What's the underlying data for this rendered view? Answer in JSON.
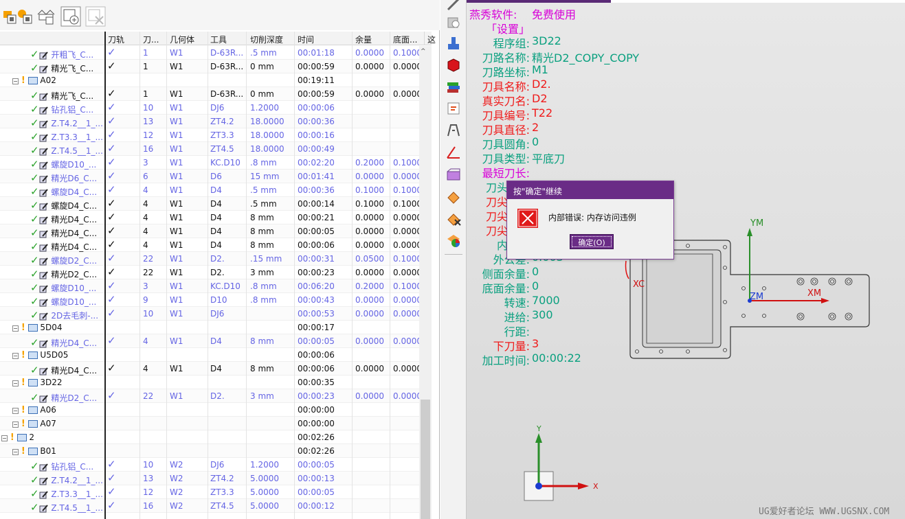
{
  "columns": [
    "刀轨",
    "刀...",
    "几何体",
    "工具",
    "切削深度",
    "时间",
    "余量",
    "底面...",
    "这"
  ],
  "rows": [
    {
      "depth": 3,
      "kind": "op",
      "style": "blue",
      "name": "开粗飞_C...",
      "cells": [
        "1",
        "W1",
        "D-63R...",
        ".5 mm",
        "00:01:18",
        "0.0000",
        "0.1000"
      ]
    },
    {
      "depth": 3,
      "kind": "op",
      "style": "black",
      "name": "精光飞_C...",
      "cells": [
        "1",
        "W1",
        "D-63R...",
        "0 mm",
        "00:00:59",
        "0.0000",
        "0.0000"
      ]
    },
    {
      "depth": 2,
      "kind": "group",
      "style": "group",
      "name": "A02",
      "cells": [
        "",
        "",
        "",
        "",
        "00:19:11",
        "",
        ""
      ]
    },
    {
      "depth": 3,
      "kind": "op",
      "style": "black",
      "name": "精光飞_C...",
      "cells": [
        "1",
        "W1",
        "D-63R...",
        "0 mm",
        "00:00:59",
        "0.0000",
        "0.0000"
      ]
    },
    {
      "depth": 3,
      "kind": "op",
      "style": "blue",
      "name": "钻孔铝_C...",
      "cells": [
        "10",
        "W1",
        "DJ6",
        "1.2000",
        "00:00:06",
        "",
        ""
      ]
    },
    {
      "depth": 3,
      "kind": "op",
      "style": "blue",
      "name": "Z.T4.2__1_...",
      "cells": [
        "13",
        "W1",
        "ZT4.2",
        "18.0000",
        "00:00:36",
        "",
        ""
      ]
    },
    {
      "depth": 3,
      "kind": "op",
      "style": "blue",
      "name": "Z.T3.3__1_...",
      "cells": [
        "12",
        "W1",
        "ZT3.3",
        "18.0000",
        "00:00:16",
        "",
        ""
      ]
    },
    {
      "depth": 3,
      "kind": "op",
      "style": "blue",
      "name": "Z.T4.5__1_...",
      "cells": [
        "16",
        "W1",
        "ZT4.5",
        "18.0000",
        "00:00:49",
        "",
        ""
      ]
    },
    {
      "depth": 3,
      "kind": "op",
      "style": "blue",
      "name": "螺旋D10_...",
      "cells": [
        "3",
        "W1",
        "KC.D10",
        ".8 mm",
        "00:02:20",
        "0.2000",
        "0.1000"
      ]
    },
    {
      "depth": 3,
      "kind": "op",
      "style": "blue",
      "name": "精光D6_C...",
      "cells": [
        "6",
        "W1",
        "D6",
        "15 mm",
        "00:01:41",
        "0.0000",
        "0.0000"
      ]
    },
    {
      "depth": 3,
      "kind": "op",
      "style": "blue",
      "name": "螺旋D4_C...",
      "cells": [
        "4",
        "W1",
        "D4",
        ".5 mm",
        "00:00:36",
        "0.1000",
        "0.1000"
      ]
    },
    {
      "depth": 3,
      "kind": "op",
      "style": "black",
      "name": "螺旋D4_C...",
      "cells": [
        "4",
        "W1",
        "D4",
        ".5 mm",
        "00:00:14",
        "0.1000",
        "0.1000"
      ]
    },
    {
      "depth": 3,
      "kind": "op",
      "style": "black",
      "name": "精光D4_C...",
      "cells": [
        "4",
        "W1",
        "D4",
        "8 mm",
        "00:00:21",
        "0.0000",
        "0.0000"
      ]
    },
    {
      "depth": 3,
      "kind": "op",
      "style": "black",
      "name": "精光D4_C...",
      "cells": [
        "4",
        "W1",
        "D4",
        "8 mm",
        "00:00:05",
        "0.0000",
        "0.0000"
      ]
    },
    {
      "depth": 3,
      "kind": "op",
      "style": "black",
      "name": "精光D4_C...",
      "cells": [
        "4",
        "W1",
        "D4",
        "8 mm",
        "00:00:06",
        "0.0000",
        "0.0000"
      ]
    },
    {
      "depth": 3,
      "kind": "op",
      "style": "blue",
      "name": "螺旋D2_C...",
      "cells": [
        "22",
        "W1",
        "D2.",
        ".15 mm",
        "00:00:31",
        "0.0500",
        "0.1000"
      ]
    },
    {
      "depth": 3,
      "kind": "op",
      "style": "black",
      "name": "精光D2_C...",
      "cells": [
        "22",
        "W1",
        "D2.",
        "3 mm",
        "00:00:23",
        "0.0000",
        "0.0000"
      ]
    },
    {
      "depth": 3,
      "kind": "op",
      "style": "blue",
      "name": "螺旋D10_...",
      "cells": [
        "3",
        "W1",
        "KC.D10",
        ".8 mm",
        "00:06:20",
        "0.2000",
        "0.1000"
      ]
    },
    {
      "depth": 3,
      "kind": "op",
      "style": "blue",
      "name": "螺旋D10_...",
      "cells": [
        "9",
        "W1",
        "D10",
        ".8 mm",
        "00:00:43",
        "0.0000",
        "0.0000"
      ]
    },
    {
      "depth": 3,
      "kind": "op",
      "style": "blue",
      "name": "2D去毛刺-...",
      "cells": [
        "10",
        "W1",
        "DJ6",
        "",
        "00:00:53",
        "0.0000",
        "0.0000"
      ]
    },
    {
      "depth": 2,
      "kind": "group",
      "style": "group",
      "name": "5D04",
      "cells": [
        "",
        "",
        "",
        "",
        "00:00:17",
        "",
        ""
      ]
    },
    {
      "depth": 3,
      "kind": "op",
      "style": "blue",
      "name": "精光D4_C...",
      "cells": [
        "4",
        "W1",
        "D4",
        "8 mm",
        "00:00:05",
        "0.0000",
        "0.0000"
      ]
    },
    {
      "depth": 2,
      "kind": "group",
      "style": "group",
      "name": "U5D05",
      "cells": [
        "",
        "",
        "",
        "",
        "00:00:06",
        "",
        ""
      ]
    },
    {
      "depth": 3,
      "kind": "op",
      "style": "black",
      "name": "精光D4_C...",
      "cells": [
        "4",
        "W1",
        "D4",
        "8 mm",
        "00:00:06",
        "0.0000",
        "0.0000"
      ]
    },
    {
      "depth": 2,
      "kind": "group",
      "style": "group",
      "name": "3D22",
      "cells": [
        "",
        "",
        "",
        "",
        "00:00:35",
        "",
        ""
      ]
    },
    {
      "depth": 3,
      "kind": "op",
      "style": "blue",
      "name": "精光D2_C...",
      "cells": [
        "22",
        "W1",
        "D2.",
        "3 mm",
        "00:00:23",
        "0.0000",
        "0.0000"
      ]
    },
    {
      "depth": 2,
      "kind": "group",
      "style": "group",
      "name": "A06",
      "cells": [
        "",
        "",
        "",
        "",
        "00:00:00",
        "",
        ""
      ]
    },
    {
      "depth": 2,
      "kind": "group",
      "style": "group",
      "name": "A07",
      "cells": [
        "",
        "",
        "",
        "",
        "00:00:00",
        "",
        ""
      ]
    },
    {
      "depth": 1,
      "kind": "group",
      "style": "group",
      "name": "2",
      "cells": [
        "",
        "",
        "",
        "",
        "00:02:26",
        "",
        ""
      ]
    },
    {
      "depth": 2,
      "kind": "group",
      "style": "group",
      "name": "B01",
      "cells": [
        "",
        "",
        "",
        "",
        "00:02:26",
        "",
        ""
      ]
    },
    {
      "depth": 3,
      "kind": "op",
      "style": "blue",
      "name": "钻孔铝_C...",
      "cells": [
        "10",
        "W2",
        "DJ6",
        "1.2000",
        "00:00:05",
        "",
        ""
      ]
    },
    {
      "depth": 3,
      "kind": "op",
      "style": "blue",
      "name": "Z.T4.2__1_...",
      "cells": [
        "13",
        "W2",
        "ZT4.2",
        "5.0000",
        "00:00:13",
        "",
        ""
      ]
    },
    {
      "depth": 3,
      "kind": "op",
      "style": "blue",
      "name": "Z.T3.3__1_...",
      "cells": [
        "12",
        "W2",
        "ZT3.3",
        "5.0000",
        "00:00:05",
        "",
        ""
      ]
    },
    {
      "depth": 3,
      "kind": "op",
      "style": "blue",
      "name": "Z.T4.5__1_...",
      "cells": [
        "16",
        "W2",
        "ZT4.5",
        "5.0000",
        "00:00:12",
        "",
        ""
      ]
    }
  ],
  "info": [
    {
      "label": "燕秀软件:",
      "value": "免费使用",
      "lc": "mag",
      "vc": "mag",
      "left": true
    },
    {
      "label": "「设置」",
      "value": "",
      "lc": "mag",
      "vc": "mag",
      "indent": true
    },
    {
      "label": "程序组:",
      "value": "3D22",
      "lc": "teal",
      "vc": "teal"
    },
    {
      "label": "刀路名称:",
      "value": "精光D2_COPY_COPY",
      "lc": "teal",
      "vc": "teal"
    },
    {
      "label": "刀路坐标:",
      "value": "M1",
      "lc": "teal",
      "vc": "teal"
    },
    {
      "label": "刀具名称:",
      "value": "D2.",
      "lc": "red",
      "vc": "red"
    },
    {
      "label": "真实刀名:",
      "value": "D2",
      "lc": "red",
      "vc": "red"
    },
    {
      "label": "刀具编号:",
      "value": "T22",
      "lc": "red",
      "vc": "red"
    },
    {
      "label": "刀具直径:",
      "value": "2",
      "lc": "red",
      "vc": "red"
    },
    {
      "label": "刀具圆角:",
      "value": "0",
      "lc": "teal",
      "vc": "teal"
    },
    {
      "label": "刀具类型:",
      "value": "平底刀",
      "lc": "teal",
      "vc": "teal"
    },
    {
      "label": "最短刀长:",
      "value": "",
      "lc": "mag",
      "vc": "mag"
    },
    {
      "label": "刀头名称",
      "value": "",
      "lc": "teal",
      "vc": "teal"
    },
    {
      "label": "刀尖深度",
      "value": "",
      "lc": "red",
      "vc": "red"
    },
    {
      "label": "刀尖类型",
      "value": "",
      "lc": "red",
      "vc": "red"
    },
    {
      "label": "刀尖步距",
      "value": "",
      "lc": "red",
      "vc": "red"
    },
    {
      "label": "内公差",
      "value": "",
      "lc": "teal",
      "vc": "teal"
    },
    {
      "label": "外公差:",
      "value": "0.003",
      "lc": "teal",
      "vc": "teal"
    },
    {
      "label": "侧面余量:",
      "value": "0",
      "lc": "teal",
      "vc": "teal"
    },
    {
      "label": "底面余量:",
      "value": "0",
      "lc": "teal",
      "vc": "teal"
    },
    {
      "label": "转速:",
      "value": "7000",
      "lc": "teal",
      "vc": "teal"
    },
    {
      "label": "进给:",
      "value": "300",
      "lc": "teal",
      "vc": "teal"
    },
    {
      "label": "行距:",
      "value": "",
      "lc": "teal",
      "vc": "teal"
    },
    {
      "label": "下刀量:",
      "value": "3",
      "lc": "red",
      "vc": "red"
    },
    {
      "label": "加工时间:",
      "value": "00:00:22",
      "lc": "teal",
      "vc": "teal"
    }
  ],
  "dialog": {
    "title": "按\"确定\"继续",
    "message": "内部错误: 内存访问违例",
    "ok": "确定(O)"
  },
  "axes": {
    "ym": "YM",
    "xm": "XM",
    "zm": "ZM",
    "xc": "XC",
    "y": "Y",
    "x": "X"
  },
  "watermark": "UG爱好者论坛 WWW.UGSNX.COM",
  "colors": {
    "accent": "#6a2c86",
    "teal": "#0aa07f",
    "magenta": "#d800d8",
    "red": "#ef1a1a",
    "opBlue": "#6464e4"
  }
}
